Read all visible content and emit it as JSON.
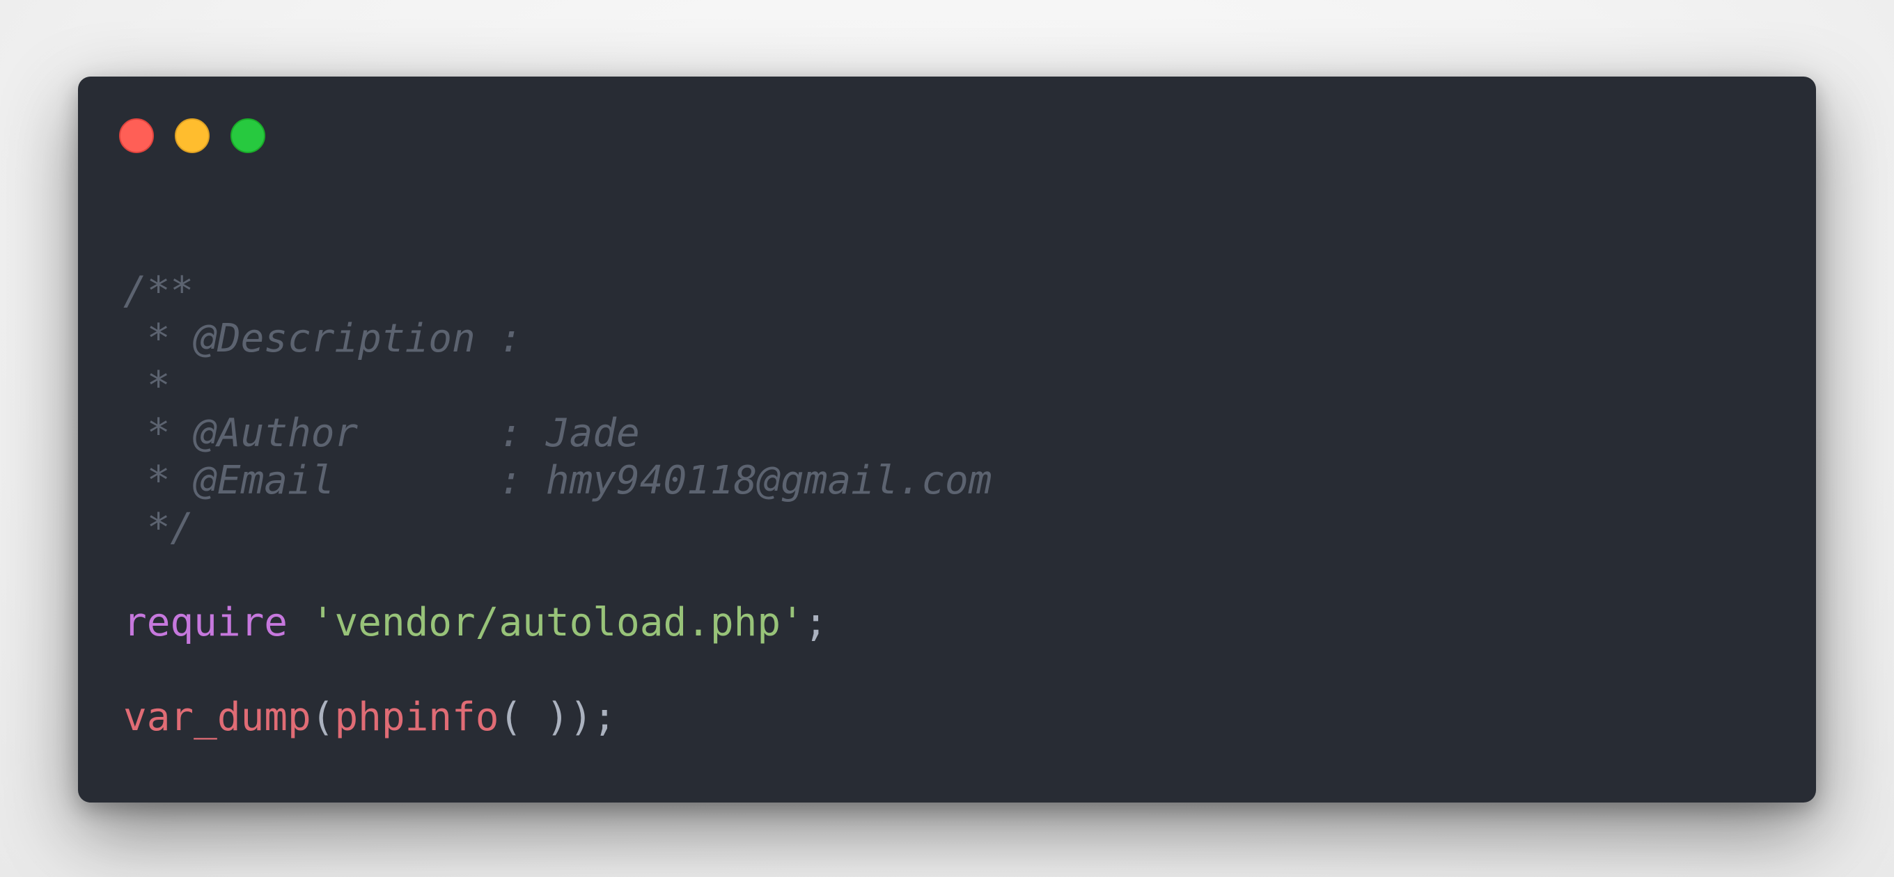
{
  "window": {
    "controls": [
      {
        "name": "close",
        "color": "#ff5f56"
      },
      {
        "name": "minimize",
        "color": "#ffbd2e"
      },
      {
        "name": "maximize",
        "color": "#27c93f"
      }
    ]
  },
  "code": {
    "language": "php",
    "comment": {
      "line1": "/**",
      "line2": " * @Description :",
      "line3": " *",
      "line4": " * @Author      : Jade",
      "line5": " * @Email       : hmy940118@gmail.com",
      "line6": " */"
    },
    "require_stmt": {
      "keyword": "require",
      "space": " ",
      "path": "'vendor/autoload.php'",
      "terminator": ";"
    },
    "dump_stmt": {
      "func": "var_dump",
      "open_paren": "(",
      "inner_func": "phpinfo",
      "inner_parens": "( )",
      "close": ");"
    }
  },
  "colors": {
    "background": "#282c34",
    "comment": "#5c6370",
    "keyword": "#c678dd",
    "string": "#98c379",
    "function": "#e06c75",
    "punctuation": "#abb2bf"
  }
}
